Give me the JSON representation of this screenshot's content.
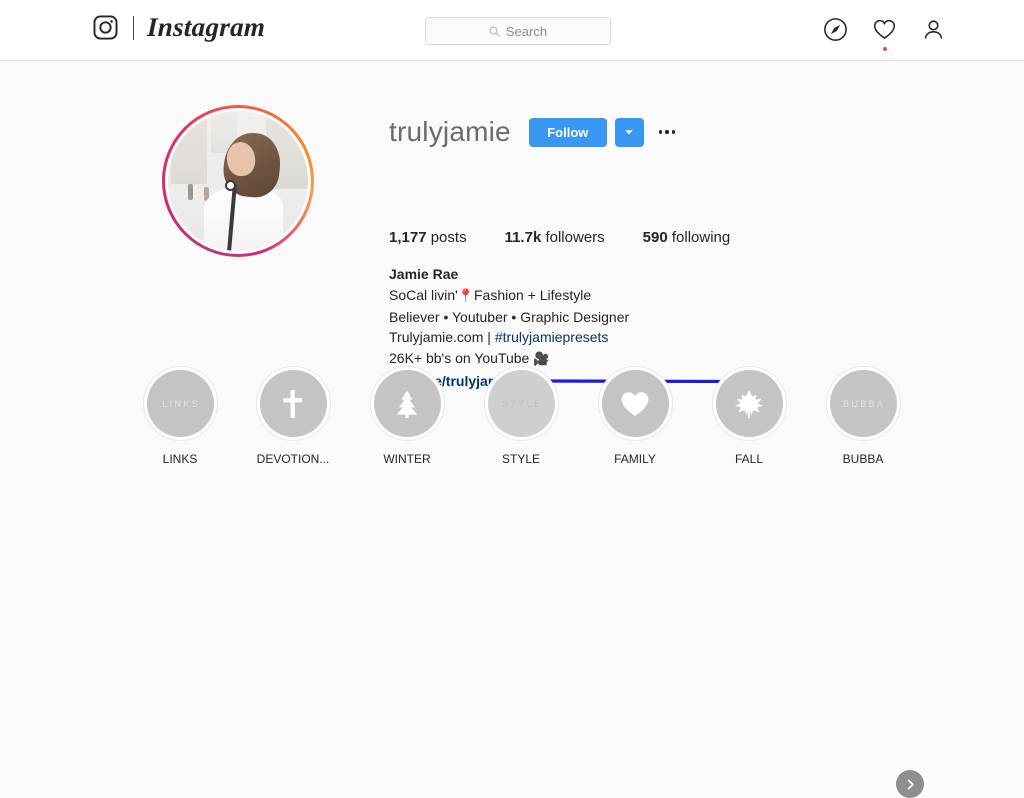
{
  "header": {
    "brand": "Instagram",
    "camera_icon": "camera-icon",
    "search": {
      "placeholder": "Search",
      "value": "",
      "icon": "search-icon"
    },
    "nav": [
      {
        "name": "explore-icon",
        "label": "Explore"
      },
      {
        "name": "activity-heart-icon",
        "label": "Activity",
        "has_notification": true
      },
      {
        "name": "profile-person-icon",
        "label": "Profile"
      }
    ]
  },
  "profile": {
    "username": "trulyjamie",
    "avatar_alt": "profile-photo",
    "follow_button": "Follow",
    "caret_button": "chevron-down-icon",
    "more_button": "options-ellipsis",
    "stats": [
      {
        "value": "1,177",
        "label": "posts"
      },
      {
        "value": "11.7k",
        "label": "followers"
      },
      {
        "value": "590",
        "label": "following"
      }
    ],
    "bio": {
      "full_name": "Jamie Rae",
      "line1_a": "SoCal livin'",
      "line1_emoji": "📍",
      "line1_b": "Fashion + Lifestyle",
      "line2": "Believer • Youtuber • Graphic Designer",
      "line3_a": "Trulyjamie.com | ",
      "line3_tag": "#trulyjamiepresets",
      "line4_a": "26K+ bb's on YouTube ",
      "line4_emoji": "🎥",
      "link": "linktr.ee/trulyjamie"
    }
  },
  "annotation": {
    "arrow_color": "#1a1ae6",
    "points_to": "linktr.ee/trulyjamie"
  },
  "highlights": {
    "next_button": "next-highlight-arrow",
    "items": [
      {
        "label": "LINKS",
        "cover_type": "text",
        "cover_text": "LINKS",
        "glyph": "",
        "light": false
      },
      {
        "label": "DEVOTION...",
        "cover_type": "glyph",
        "cover_text": "",
        "glyph": "cross-icon",
        "light": false
      },
      {
        "label": "WINTER",
        "cover_type": "glyph",
        "cover_text": "",
        "glyph": "tree-icon",
        "light": false
      },
      {
        "label": "STYLE",
        "cover_type": "text",
        "cover_text": "STYLE",
        "glyph": "",
        "light": true
      },
      {
        "label": "FAMILY",
        "cover_type": "glyph",
        "cover_text": "",
        "glyph": "heart-icon",
        "light": false
      },
      {
        "label": "FALL",
        "cover_type": "glyph",
        "cover_text": "",
        "glyph": "leaf-icon",
        "light": false
      },
      {
        "label": "BUBBA",
        "cover_type": "text",
        "cover_text": "BUBBA",
        "glyph": "",
        "light": false
      }
    ]
  },
  "colors": {
    "accent_blue": "#3897f0",
    "link_blue": "#00376b",
    "page_bg": "#fafafa",
    "notification_red": "#ed4956"
  }
}
